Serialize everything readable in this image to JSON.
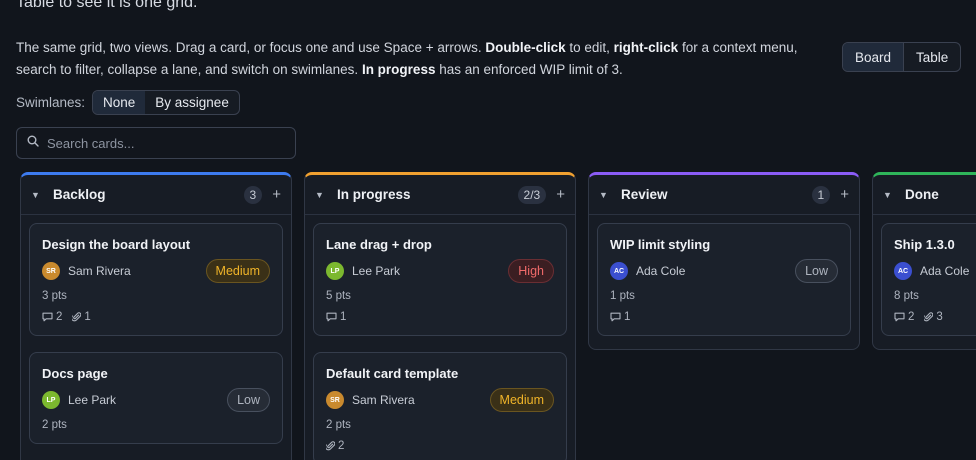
{
  "intro": {
    "top_text": "Table to see it is one grid.",
    "p1": "The same grid, two views. Drag a card, or focus one and use Space + arrows. ",
    "b1": "Double-click",
    "p2": " to edit, ",
    "b2": "right-click",
    "p3": " for a context menu, search to filter, collapse a lane, and switch on swimlanes. ",
    "b3": "In progress",
    "p4": " has an enforced WIP limit of 3."
  },
  "view_toggle": {
    "board": "Board",
    "table": "Table",
    "selected": "Board"
  },
  "swimlanes": {
    "label": "Swimlanes:",
    "none": "None",
    "by_assignee": "By assignee",
    "selected": "None"
  },
  "search": {
    "placeholder": "Search cards...",
    "value": ""
  },
  "colors": {
    "backlog": "#3d7bf0",
    "in_progress": "#f0a030",
    "review": "#8b5cf6",
    "done": "#2fb55a",
    "SR": "#c98a2e",
    "LP": "#7cb82f",
    "AC": "#3b4fd0"
  },
  "lanes": [
    {
      "title": "Backlog",
      "count": "3",
      "add": "+",
      "color": "#3d7bf0",
      "cards": [
        {
          "title": "Design the board layout",
          "initials": "SR",
          "assignee": "Sam Rivera",
          "priority": "Medium",
          "points": "3 pts",
          "comments": "2",
          "attachments": "1"
        },
        {
          "title": "Docs page",
          "initials": "LP",
          "assignee": "Lee Park",
          "priority": "Low",
          "points": "2 pts",
          "comments": "",
          "attachments": ""
        }
      ]
    },
    {
      "title": "In progress",
      "count": "2/3",
      "add": "+",
      "color": "#f0a030",
      "cards": [
        {
          "title": "Lane drag + drop",
          "initials": "LP",
          "assignee": "Lee Park",
          "priority": "High",
          "points": "5 pts",
          "comments": "1",
          "attachments": ""
        },
        {
          "title": "Default card template",
          "initials": "SR",
          "assignee": "Sam Rivera",
          "priority": "Medium",
          "points": "2 pts",
          "comments": "",
          "attachments": "2"
        }
      ]
    },
    {
      "title": "Review",
      "count": "1",
      "add": "+",
      "color": "#8b5cf6",
      "cards": [
        {
          "title": "WIP limit styling",
          "initials": "AC",
          "assignee": "Ada Cole",
          "priority": "Low",
          "points": "1 pts",
          "comments": "1",
          "attachments": ""
        }
      ]
    },
    {
      "title": "Done",
      "count": "",
      "add": "",
      "color": "#2fb55a",
      "cards": [
        {
          "title": "Ship 1.3.0",
          "initials": "AC",
          "assignee": "Ada Cole",
          "priority": "",
          "points": "8 pts",
          "comments": "2",
          "attachments": "3"
        }
      ]
    }
  ]
}
